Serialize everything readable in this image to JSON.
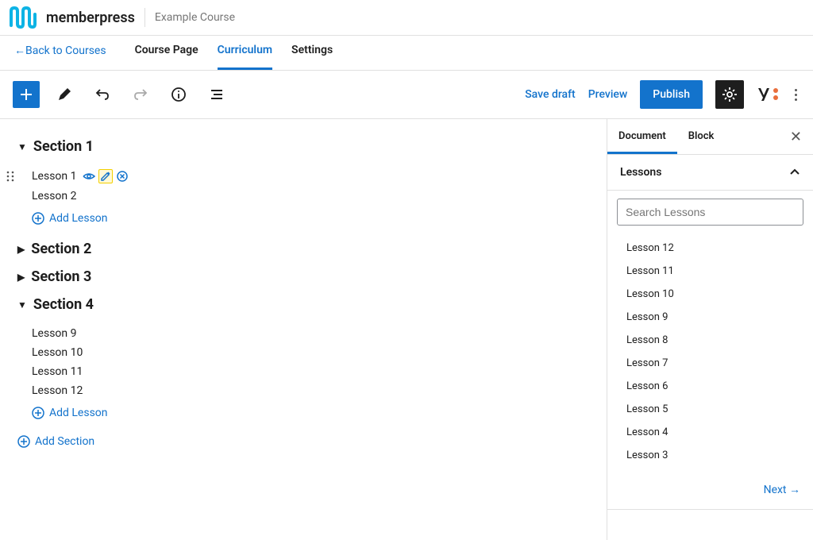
{
  "header": {
    "brand": "memberpress",
    "course_title": "Example Course",
    "back_link": "Back to Courses"
  },
  "tabs": {
    "items": [
      {
        "label": "Course Page",
        "active": false
      },
      {
        "label": "Curriculum",
        "active": true
      },
      {
        "label": "Settings",
        "active": false
      }
    ]
  },
  "toolbar": {
    "save_draft": "Save draft",
    "preview": "Preview",
    "publish": "Publish"
  },
  "curriculum": {
    "sections": [
      {
        "title": "Section 1",
        "expanded": true,
        "lessons": [
          "Lesson 1",
          "Lesson 2"
        ]
      },
      {
        "title": "Section 2",
        "expanded": false,
        "lessons": []
      },
      {
        "title": "Section 3",
        "expanded": false,
        "lessons": []
      },
      {
        "title": "Section 4",
        "expanded": true,
        "lessons": [
          "Lesson 9",
          "Lesson 10",
          "Lesson 11",
          "Lesson 12"
        ]
      }
    ],
    "add_lesson": "Add Lesson",
    "add_section": "Add Section"
  },
  "sidebar": {
    "tabs": [
      {
        "label": "Document",
        "active": true
      },
      {
        "label": "Block",
        "active": false
      }
    ],
    "panel_title": "Lessons",
    "search_placeholder": "Search Lessons",
    "lesson_items": [
      "Lesson 12",
      "Lesson 11",
      "Lesson 10",
      "Lesson 9",
      "Lesson 8",
      "Lesson 7",
      "Lesson 6",
      "Lesson 5",
      "Lesson 4",
      "Lesson 3"
    ],
    "next": "Next"
  }
}
